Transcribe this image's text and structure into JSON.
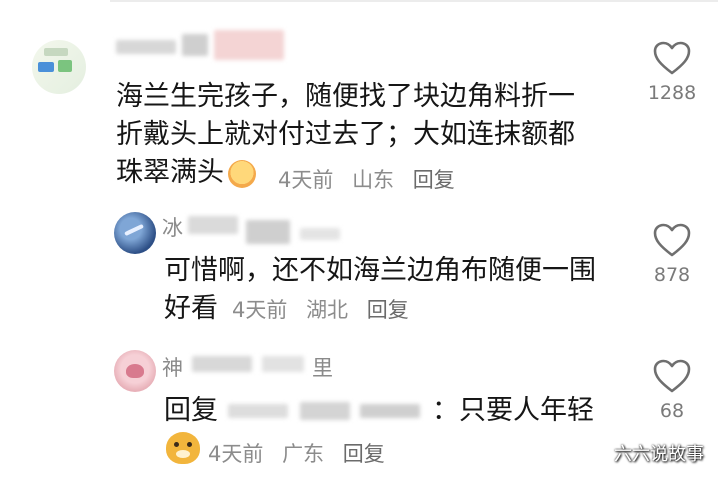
{
  "comments": [
    {
      "username": "",
      "text": "海兰生完孩子，随便找了块边角料折一折戴头上就对付过去了；大如连抹额都珠翠满头",
      "text_line1": "海兰生完孩子，随便找了块边角料折一",
      "text_line2": "折戴头上就对付过去了；大如连抹额都",
      "text_line3": "珠翠满头",
      "time": "4天前",
      "location": "山东",
      "reply_label": "回复",
      "likes": "1288"
    },
    {
      "username": "冰",
      "text": "可惜啊，还不如海兰边角布随便一围好看",
      "text_line1": "可惜啊，还不如海兰边角布随便一围",
      "text_line2": "好看",
      "time": "4天前",
      "location": "湖北",
      "reply_label": "回复",
      "likes": "878"
    },
    {
      "username": "神",
      "username_tail": "里",
      "reply_prefix": "回复",
      "text": "：只要人年轻",
      "time": "4天前",
      "location": "广东",
      "reply_label": "回复",
      "likes": "68"
    }
  ],
  "watermark": "六六说故事",
  "icons": {
    "like": "heart-outline-icon",
    "emoji": "crying-face-icon",
    "sticker": "cartoon-dog-avatar-icon"
  },
  "colors": {
    "text": "#161616",
    "meta": "#8c8c8c",
    "heart": "#6f6f6f"
  }
}
